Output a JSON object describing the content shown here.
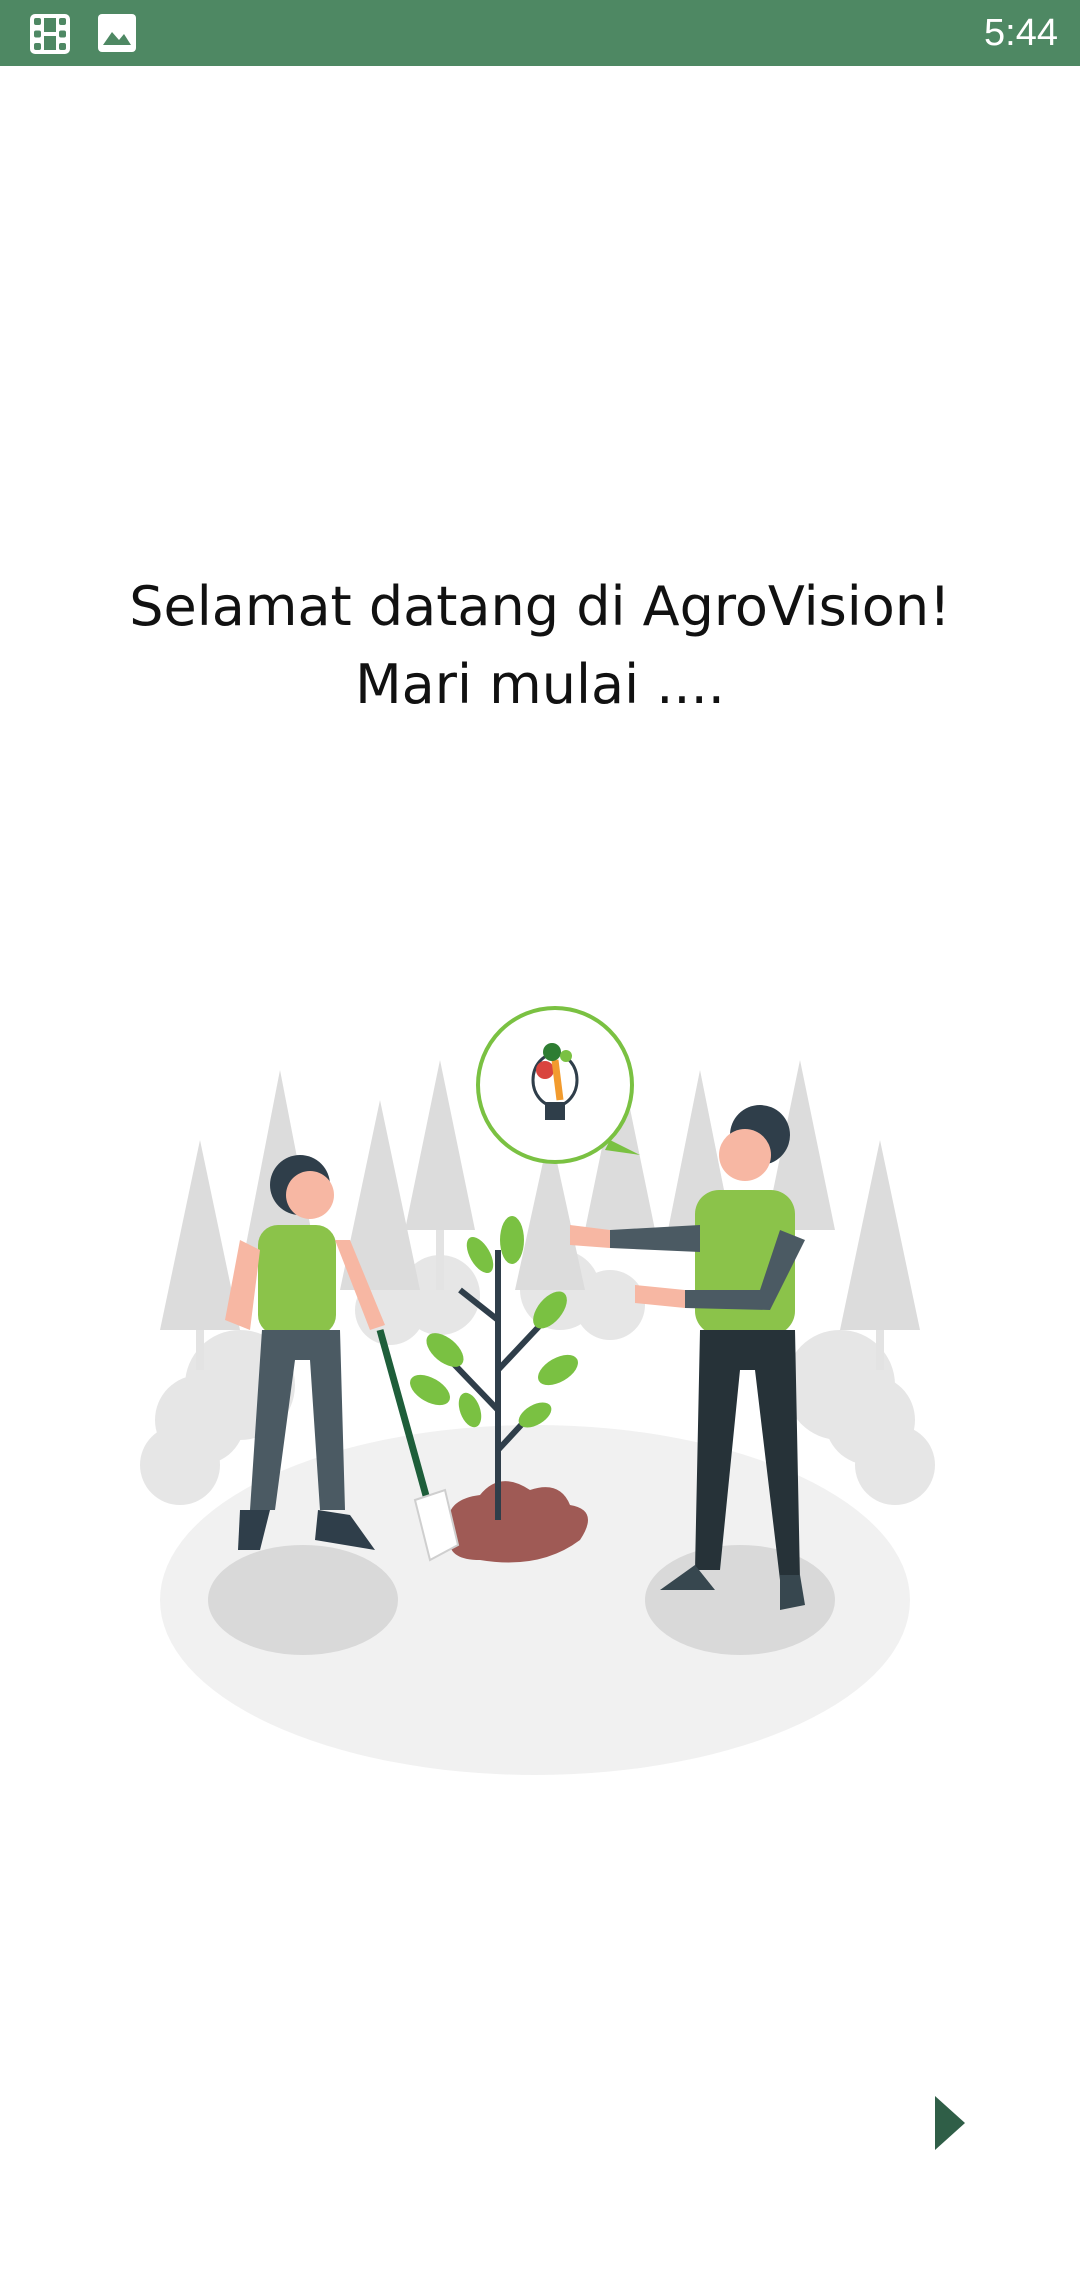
{
  "status_bar": {
    "time": "5:44",
    "icons": [
      "film-icon",
      "image-icon"
    ],
    "background_color": "#4e8863"
  },
  "welcome": {
    "line1": "Selamat datang di AgroVision!",
    "line2": "Mari mulai ...."
  },
  "illustration": {
    "description_icon": "planting-illustration"
  },
  "navigation": {
    "next_icon": "play-arrow-icon",
    "next_color": "#2f5e47"
  }
}
